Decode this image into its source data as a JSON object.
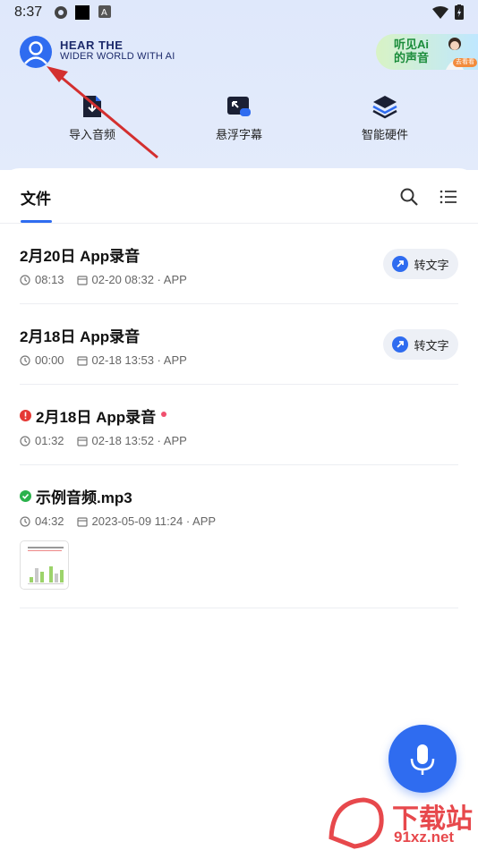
{
  "status_bar": {
    "time": "8:37"
  },
  "header": {
    "brand_line1": "HEAR THE",
    "brand_line2": "WIDER WORLD WITH AI",
    "promo_line1": "听见Ai",
    "promo_line2": "的声音",
    "promo_badge": "去看看"
  },
  "actions": [
    {
      "label": "导入音频",
      "icon": "import-audio-icon"
    },
    {
      "label": "悬浮字幕",
      "icon": "floating-subtitle-icon"
    },
    {
      "label": "智能硬件",
      "icon": "smart-hardware-icon"
    }
  ],
  "tabs": {
    "files_label": "文件"
  },
  "items": [
    {
      "title": "2月20日 App录音",
      "duration": "08:13",
      "date": "02-20  08:32 · APP",
      "button": "转文字",
      "status": "none"
    },
    {
      "title": "2月18日 App录音",
      "duration": "00:00",
      "date": "02-18  13:53 · APP",
      "button": "转文字",
      "status": "none"
    },
    {
      "title": "2月18日 App录音",
      "duration": "01:32",
      "date": "02-18  13:52 · APP",
      "button": "",
      "status": "error"
    },
    {
      "title": "示例音频.mp3",
      "duration": "04:32",
      "date": "2023-05-09  11:24 · APP",
      "button": "",
      "status": "done"
    }
  ],
  "watermark": {
    "site_cn": "下载站",
    "site_url": "91xz.net"
  },
  "colors": {
    "accent": "#2f6cf0",
    "error": "#e53935",
    "success": "#2bb24c",
    "header_bg": "#e0e9fb"
  }
}
